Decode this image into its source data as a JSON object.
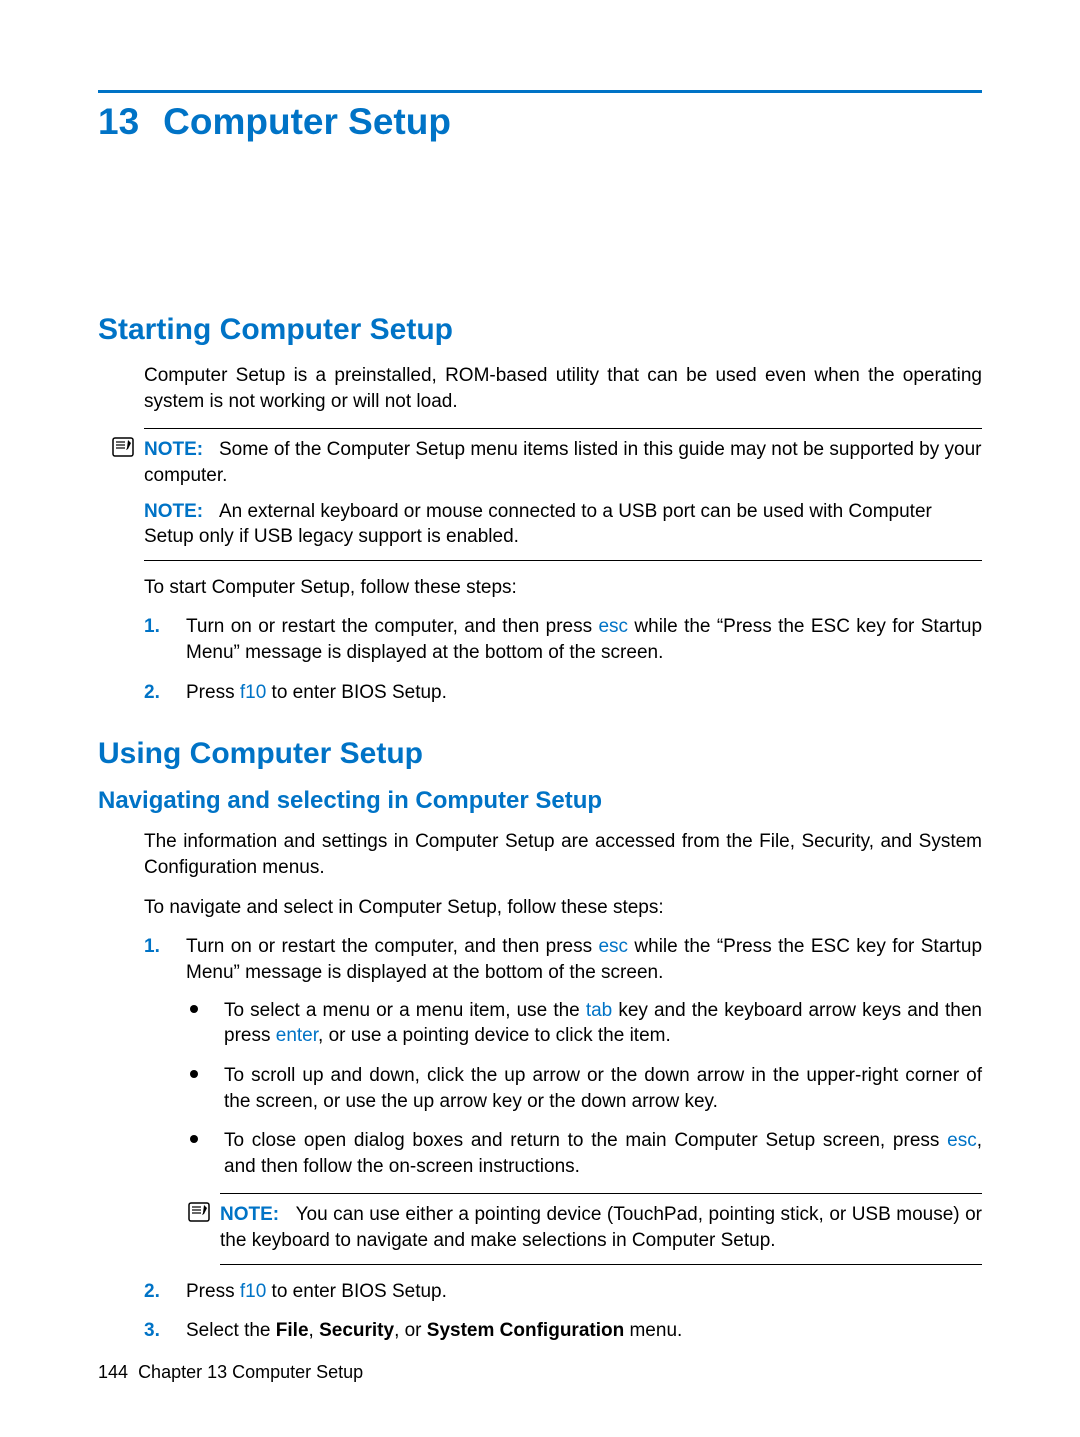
{
  "chapter": {
    "number": "13",
    "title": "Computer Setup"
  },
  "s1": {
    "heading": "Starting Computer Setup",
    "intro": "Computer Setup is a preinstalled, ROM-based utility that can be used even when the operating system is not working or will not load.",
    "note1_label": "NOTE:",
    "note1_text": "Some of the Computer Setup menu items listed in this guide may not be supported by your computer.",
    "note2_label": "NOTE:",
    "note2_text": "An external keyboard or mouse connected to a USB port can be used with Computer Setup only if USB legacy support is enabled.",
    "lead": "To start Computer Setup, follow these steps:",
    "step1_marker": "1.",
    "step1_a": "Turn on or restart the computer, and then press ",
    "step1_key": "esc",
    "step1_b": " while the “Press the ESC key for Startup Menu” message is displayed at the bottom of the screen.",
    "step2_marker": "2.",
    "step2_a": "Press ",
    "step2_key": "f10",
    "step2_b": " to enter BIOS Setup."
  },
  "s2": {
    "heading": "Using Computer Setup",
    "sub1": "Navigating and selecting in Computer Setup",
    "p1": "The information and settings in Computer Setup are accessed from the File, Security, and System Configuration menus.",
    "p2": "To navigate and select in Computer Setup, follow these steps:",
    "step1_marker": "1.",
    "step1_a": "Turn on or restart the computer, and then press ",
    "step1_key": "esc",
    "step1_b": " while the “Press the ESC key for Startup Menu” message is displayed at the bottom of the screen.",
    "b1_a": "To select a menu or a menu item, use the ",
    "b1_key1": "tab",
    "b1_b": " key and the keyboard arrow keys and then press ",
    "b1_key2": "enter",
    "b1_c": ", or use a pointing device to click the item.",
    "b2": "To scroll up and down, click the up arrow or the down arrow in the upper-right corner of the screen, or use the up arrow key or the down arrow key.",
    "b3_a": "To close open dialog boxes and return to the main Computer Setup screen, press ",
    "b3_key": "esc",
    "b3_b": ", and then follow the on-screen instructions.",
    "note_label": "NOTE:",
    "note_text": "You can use either a pointing device (TouchPad, pointing stick, or USB mouse) or the keyboard to navigate and make selections in Computer Setup.",
    "step2_marker": "2.",
    "step2_a": "Press ",
    "step2_key": "f10",
    "step2_b": " to enter BIOS Setup.",
    "step3_marker": "3.",
    "step3_a": "Select the ",
    "step3_b1": "File",
    "step3_c1": ", ",
    "step3_b2": "Security",
    "step3_c2": ", or ",
    "step3_b3": "System Configuration",
    "step3_d": " menu."
  },
  "footer": {
    "page": "144",
    "label": "Chapter 13   Computer Setup"
  }
}
